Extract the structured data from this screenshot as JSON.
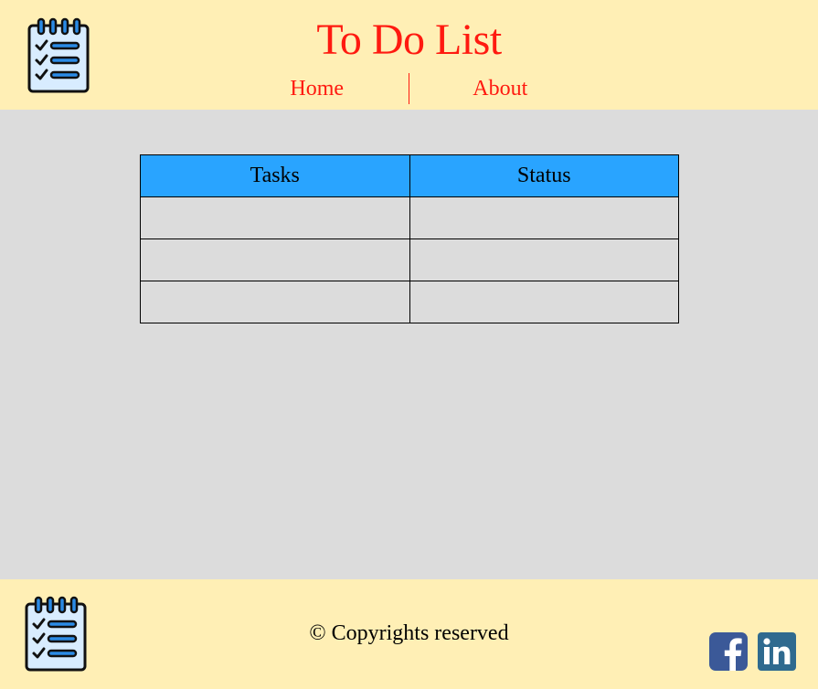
{
  "header": {
    "title": "To Do List",
    "logo_icon": "checklist-notepad-icon"
  },
  "nav": {
    "items": [
      {
        "label": "Home"
      },
      {
        "label": "About"
      }
    ]
  },
  "table": {
    "headers": [
      "Tasks",
      "Status"
    ],
    "rows": [
      [
        "",
        ""
      ],
      [
        "",
        ""
      ],
      [
        "",
        ""
      ]
    ]
  },
  "footer": {
    "copyright": "© Copyrights reserved",
    "logo_icon": "checklist-notepad-icon",
    "social": [
      {
        "name": "facebook-icon",
        "color": "#3b5998"
      },
      {
        "name": "linkedin-icon",
        "color": "#2f6a8f"
      }
    ]
  },
  "colors": {
    "accent_red": "#ff1a10",
    "header_bg": "#ffefb5",
    "table_header_bg": "#29a4ff",
    "main_bg": "#dcdcdc"
  }
}
